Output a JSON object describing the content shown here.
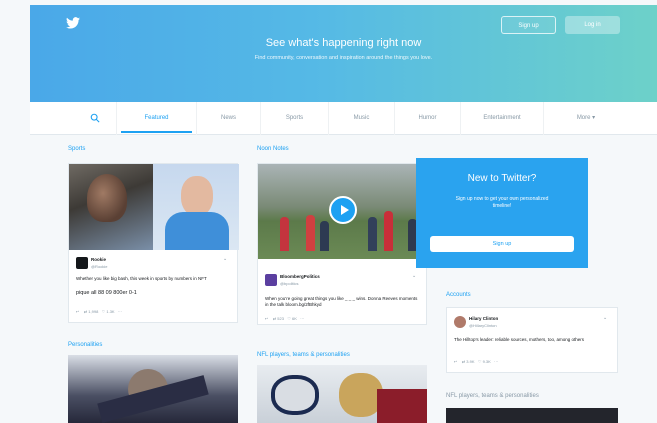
{
  "header": {
    "signup_label": "Sign up",
    "login_label": "Log in",
    "title": "See what's happening right now",
    "subtitle": "Find community, conversation and inspiration around the things you love."
  },
  "nav": {
    "items": [
      "Featured",
      "News",
      "Sports",
      "Music",
      "Humor",
      "Entertainment",
      "More"
    ]
  },
  "sections": {
    "col1_title": "Sports",
    "col1_bottom_title": "Personalities",
    "col2_title": "Noon Notes",
    "col2_bottom_title": "NFL players, teams & personalities",
    "col3_accounts_title": "Accounts",
    "col3_bottom_title": "NFL players, teams & personalities"
  },
  "tweets": [
    {
      "name": "Rookie",
      "handle": "@Rookie",
      "text": "Whether you like big bash, this week in sports by numbers in NFT",
      "highlight": "pique all 88 09 800er 0-1",
      "retweets": "1,998",
      "likes": "1.3K"
    },
    {
      "name": "BloombergPolitics",
      "handle": "@bpolitics",
      "text": "When you’re going great things you like _ _ _ wins. Donna Reeves moments in the talk bloom.bg/2fBhkyd",
      "retweets": "523",
      "likes": "6K"
    },
    {
      "name": "Hilary Clinton",
      "handle": "@HillaryClinton",
      "text": "The Hilltop’s leader: reliable sources, mothers, too, among others",
      "retweets": "3.9K",
      "likes": "9.3K"
    }
  ],
  "signup_box": {
    "title": "New to Twitter?",
    "text": "Sign up now to get your own personalized timeline!",
    "button": "Sign up"
  },
  "colors": {
    "brand": "#1da1f2",
    "hero_start": "#4aa8e8",
    "hero_end": "#6dd1c9"
  },
  "icons": {
    "logo": "twitter-bird-icon",
    "search": "search-icon",
    "play": "play-icon"
  }
}
